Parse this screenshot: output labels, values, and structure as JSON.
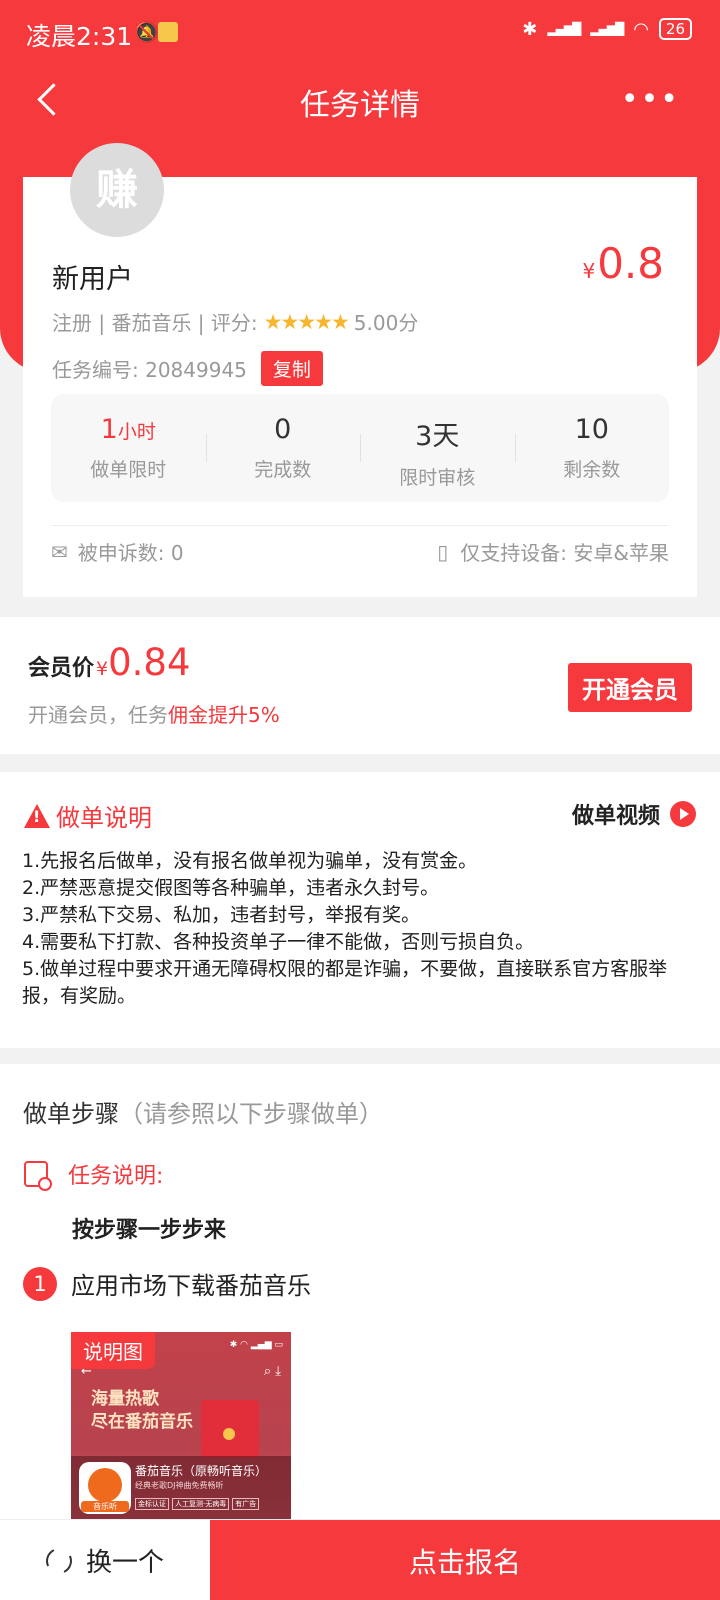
{
  "status_bar": {
    "time": "凌晨2:31",
    "battery": "26"
  },
  "nav": {
    "title": "任务详情",
    "more": "•••"
  },
  "task": {
    "avatar_char": "赚",
    "name": "新用户",
    "price_currency": "¥",
    "price": "0.8",
    "meta_prefix": "注册 | 番茄音乐 | 评分:",
    "rating_stars": "★★★★★",
    "rating": 5.0,
    "rating_text": "5.00分",
    "task_no_label": "任务编号:",
    "task_no": "20849945",
    "copy_label": "复制",
    "stats": [
      {
        "value": "1",
        "unit": "小时",
        "label": "做单限时"
      },
      {
        "value": "0",
        "unit": "",
        "label": "完成数"
      },
      {
        "value": "3天",
        "unit": "",
        "label": "限时审核"
      },
      {
        "value": "10",
        "unit": "",
        "label": "剩余数"
      }
    ],
    "complaints": "被申诉数: 0",
    "device": "仅支持设备: 安卓&苹果"
  },
  "vip": {
    "label": "会员价",
    "currency": "¥",
    "price": "0.84",
    "desc_prefix": "开通会员，任务",
    "desc_highlight": "佣金提升5%",
    "button": "开通会员"
  },
  "notes": {
    "title": "做单说明",
    "video_label": "做单视频",
    "rules": [
      "1.先报名后做单，没有报名做单视为骗单，没有赏金。",
      "2.严禁恶意提交假图等各种骗单，违者永久封号。",
      "3.严禁私下交易、私加，违者封号，举报有奖。",
      "4.需要私下打款、各种投资单子一律不能做，否则亏损自负。",
      "5.做单过程中要求开通无障碍权限的都是诈骗，不要做，直接联系官方客服举报，有奖励。"
    ]
  },
  "steps": {
    "title": "做单步骤",
    "hint": "（请参照以下步骤做单）",
    "task_desc_label": "任务说明:",
    "task_desc_body": "按步骤一步步来",
    "items": [
      {
        "num": "1",
        "text": "应用市场下载番茄音乐"
      }
    ],
    "image": {
      "tag": "说明图",
      "slogan_line1": "海量热歌",
      "slogan_line2": "尽在番茄音乐",
      "logo_label": "音乐听",
      "app_name": "番茄音乐（原畅听音乐）",
      "app_sub": "经典老歌DJ神曲免费畅听",
      "chips": [
        "金标认证",
        "人工复测·无病毒",
        "有广告"
      ]
    }
  },
  "bottom": {
    "refresh_label": "换一个",
    "signup_label": "点击报名"
  },
  "colors": {
    "brand_red": "#f5393d",
    "star": "#f6b62f"
  }
}
